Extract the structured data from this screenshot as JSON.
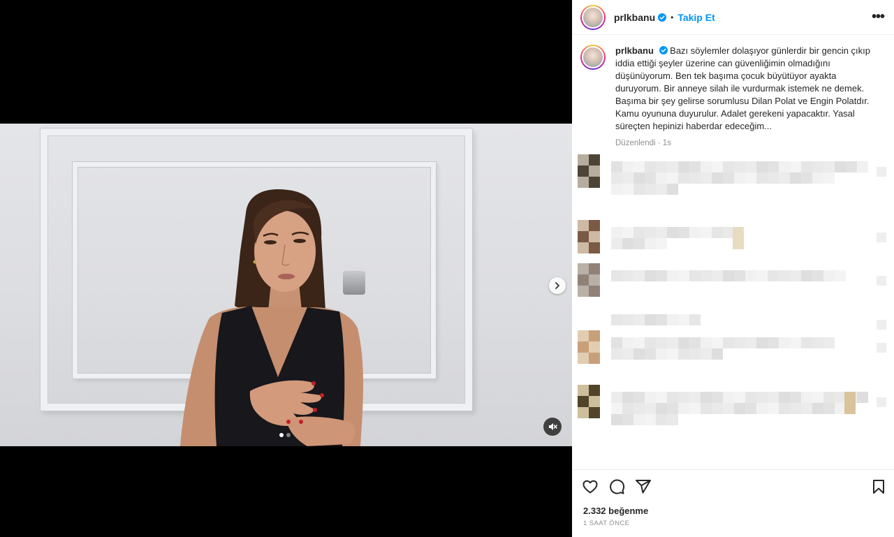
{
  "post": {
    "username": "prlkbanu",
    "follow_label": "Takip Et",
    "bullet": "•",
    "more_label": "•••"
  },
  "caption": {
    "username": "prlkbanu",
    "text": "Bazı söylemler dolaşıyor günlerdir bir gencin çıkıp iddia ettiği şeyler üzerine can güvenliğimin olmadığını düşünüyorum. Ben tek başıma çocuk büyütüyor ayakta duruyorum. Bir anneye silah ile vurdurmak istemek ne demek. Başıma bir şey gelirse sorumlusu Dilan Polat ve Engin Polatdır. Kamu oyununa duyurulur. Adalet gerekeni yapacaktır. Yasal süreçten hepinizi haberdar edeceğim...",
    "edited_label": "Düzenlendi",
    "separator": "·",
    "age": "1s"
  },
  "media": {
    "type": "video",
    "carousel_count": 2,
    "carousel_active": 1,
    "next_icon": "chevron-right-icon",
    "mute_icon": "muted-speaker-icon"
  },
  "footer": {
    "likes_text": "2.332 beğenme",
    "timestamp": "1 SAAT ÖNCE",
    "icons": [
      "heart-icon",
      "comment-icon",
      "share-icon",
      "bookmark-icon"
    ]
  },
  "colors": {
    "accent": "#0095f6",
    "verified": "#0095f6",
    "text": "#262626",
    "muted": "#8e8e8e"
  }
}
